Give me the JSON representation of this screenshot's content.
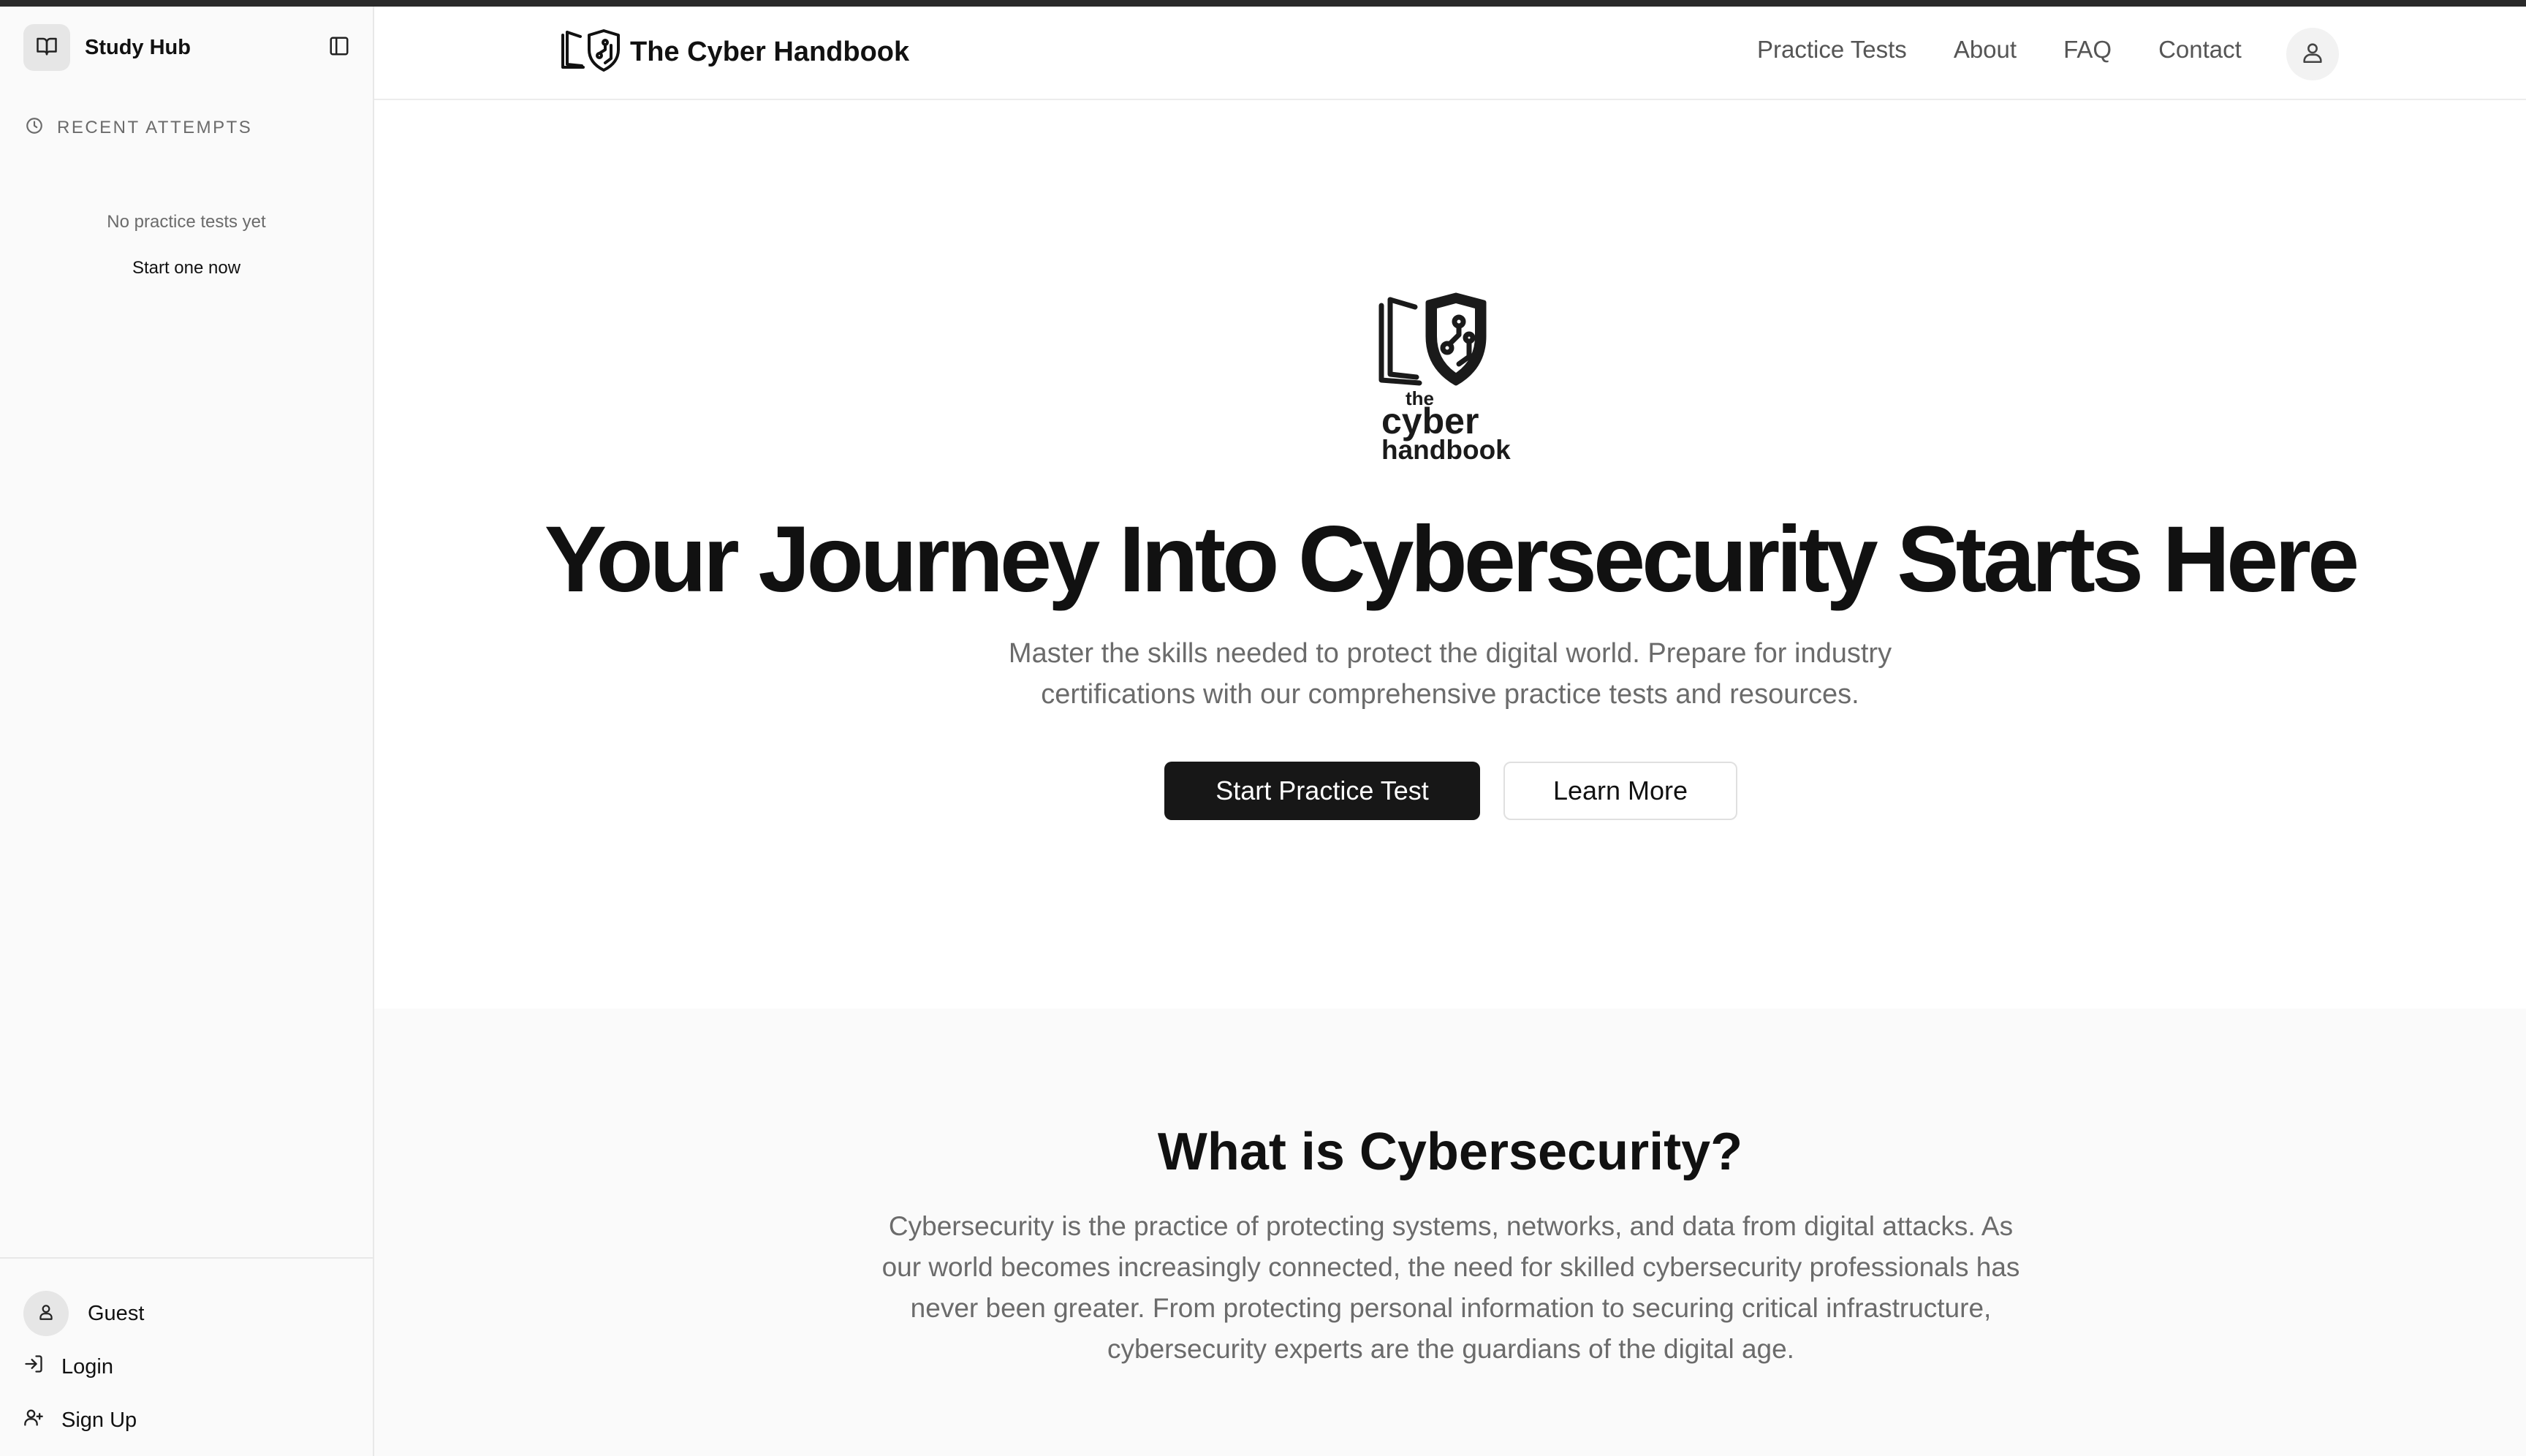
{
  "sidebar": {
    "title": "Study Hub",
    "section_label": "RECENT ATTEMPTS",
    "empty_text": "No practice tests yet",
    "start_link": "Start one now",
    "user_name": "Guest",
    "login_label": "Login",
    "signup_label": "Sign Up"
  },
  "header": {
    "brand_title": "The Cyber Handbook",
    "nav": [
      "Practice Tests",
      "About",
      "FAQ",
      "Contact"
    ]
  },
  "hero": {
    "logo_text": [
      "the",
      "cyber",
      "handbook"
    ],
    "title": "Your Journey Into Cybersecurity Starts Here",
    "subtitle_line1": "Master the skills needed to protect the digital world. Prepare for industry",
    "subtitle_line2": "certifications with our comprehensive practice tests and resources.",
    "primary_button": "Start Practice Test",
    "secondary_button": "Learn More"
  },
  "section": {
    "title": "What is Cybersecurity?",
    "body_lines": [
      "Cybersecurity is the practice of protecting systems, networks, and data from digital attacks. As",
      "our world becomes increasingly connected, the need for skilled cybersecurity professionals has",
      "never been greater. From protecting personal information to securing critical infrastructure,",
      "cybersecurity experts are the guardians of the digital age."
    ]
  },
  "colors": {
    "primary_button_bg": "#171717",
    "muted_text": "#6b6b6b",
    "sidebar_bg": "#fafafa"
  },
  "icons": [
    "book-icon",
    "sidebar-toggle-icon",
    "clock-icon",
    "user-icon",
    "login-icon",
    "user-plus-icon",
    "handbook-shield-logo"
  ]
}
